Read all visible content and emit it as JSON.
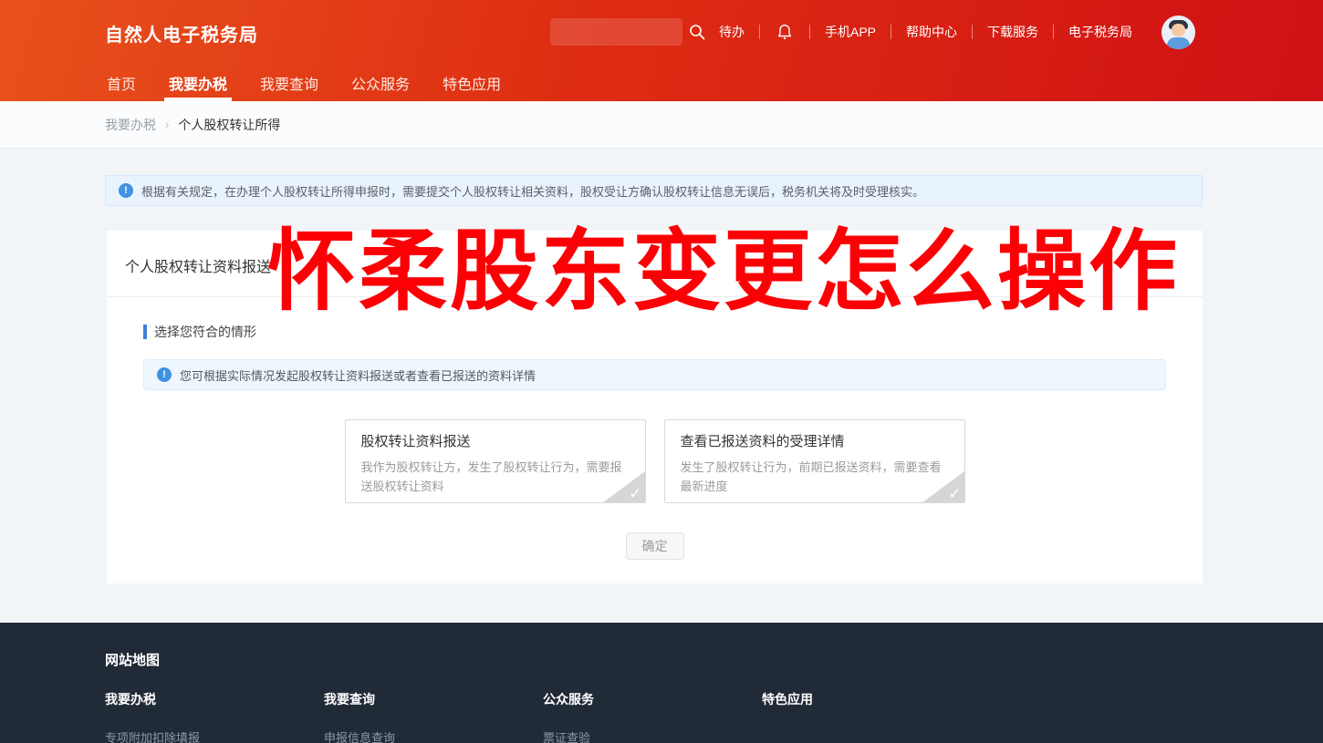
{
  "header": {
    "logo": "自然人电子税务局",
    "search": {
      "placeholder": ""
    },
    "quick_links": [
      {
        "label": "待办"
      },
      {
        "label": "手机APP"
      },
      {
        "label": "帮助中心"
      },
      {
        "label": "下载服务"
      },
      {
        "label": "电子税务局"
      }
    ],
    "nav": [
      {
        "label": "首页",
        "active": false
      },
      {
        "label": "我要办税",
        "active": true
      },
      {
        "label": "我要查询",
        "active": false
      },
      {
        "label": "公众服务",
        "active": false
      },
      {
        "label": "特色应用",
        "active": false
      }
    ]
  },
  "breadcrumb": {
    "parent": "我要办税",
    "separator": "›",
    "current": "个人股权转让所得"
  },
  "notice": {
    "icon": "info-icon",
    "text": "根据有关规定，在办理个人股权转让所得申报时，需要提交个人股权转让相关资料，股权受让方确认股权转让信息无误后，税务机关将及时受理核实。"
  },
  "main": {
    "card_title": "个人股权转让资料报送",
    "section_title": "选择您符合的情形",
    "inner_notice": "您可根据实际情况发起股权转让资料报送或者查看已报送的资料详情",
    "options": [
      {
        "title": "股权转让资料报送",
        "desc": "我作为股权转让方，发生了股权转让行为，需要报送股权转让资料",
        "check": "✓"
      },
      {
        "title": "查看已报送资料的受理详情",
        "desc": "发生了股权转让行为，前期已报送资料，需要查看最新进度",
        "check": "✓"
      }
    ],
    "confirm_label": "确定"
  },
  "watermark": "怀柔股东变更怎么操作",
  "footer": {
    "title": "网站地图",
    "columns": [
      {
        "heading": "我要办税",
        "link": "专项附加扣除填报"
      },
      {
        "heading": "我要查询",
        "link": "申报信息查询"
      },
      {
        "heading": "公众服务",
        "link": "票证查验"
      },
      {
        "heading": "特色应用",
        "link": ""
      }
    ]
  },
  "colors": {
    "brand_gradient_start": "#e8511c",
    "brand_gradient_end": "#d01115",
    "watermark_red": "#fb0105",
    "info_blue": "#4092e2",
    "section_accent_blue": "#3f80da",
    "footer_bg": "#212a37"
  }
}
